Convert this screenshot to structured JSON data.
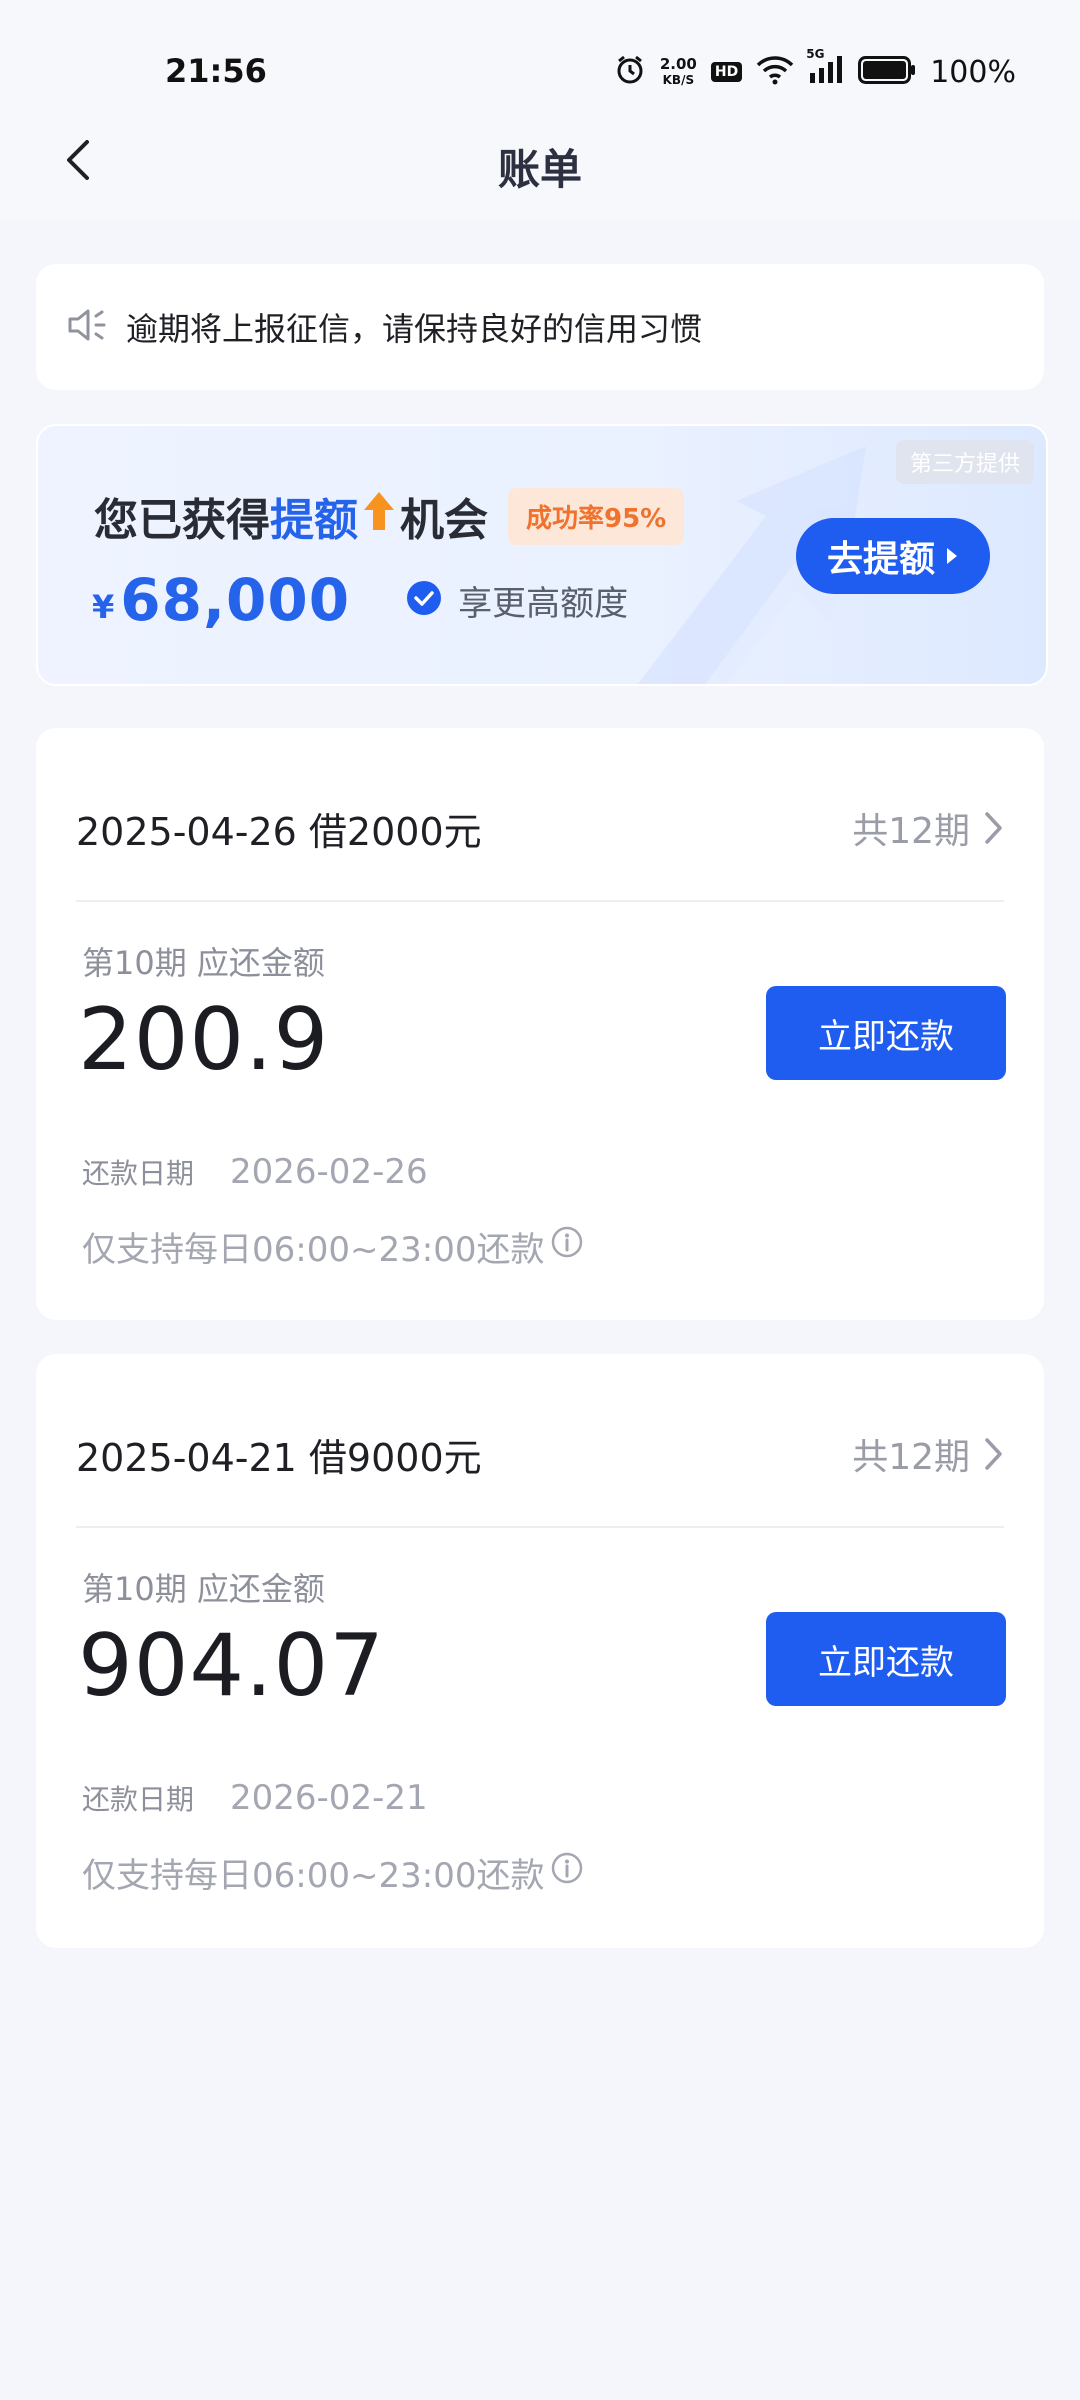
{
  "status_bar": {
    "time": "21:56",
    "net_speed_top": "2.00",
    "net_speed_bottom": "KB/S",
    "hd": "HD",
    "signal_label": "5G",
    "battery": "100%"
  },
  "nav": {
    "title": "账单"
  },
  "notice": {
    "text": "逾期将上报征信，请保持良好的信用习惯"
  },
  "banner": {
    "tag": "第三方提供",
    "headline_prefix": "您已获得",
    "headline_highlight": "提额",
    "headline_suffix": "机会",
    "rate_badge": "成功率95%",
    "currency": "¥",
    "amount": "68,000",
    "perk": "享更高额度",
    "cta": "去提额"
  },
  "loans": [
    {
      "title": "2025-04-26 借2000元",
      "terms": "共12期",
      "due_label": "第10期 应还金额",
      "due_amount": "200.9",
      "pay_button": "立即还款",
      "date_label": "还款日期",
      "date_value": "2026-02-26",
      "hours_note": "仅支持每日06:00~23:00还款"
    },
    {
      "title": "2025-04-21 借9000元",
      "terms": "共12期",
      "due_label": "第10期 应还金额",
      "due_amount": "904.07",
      "pay_button": "立即还款",
      "date_label": "还款日期",
      "date_value": "2026-02-21",
      "hours_note": "仅支持每日06:00~23:00还款"
    }
  ],
  "colors": {
    "primary": "#1f5cf0",
    "highlight_blue": "#2563eb",
    "rate_orange": "#f0722c",
    "background": "#f5f6fb"
  }
}
